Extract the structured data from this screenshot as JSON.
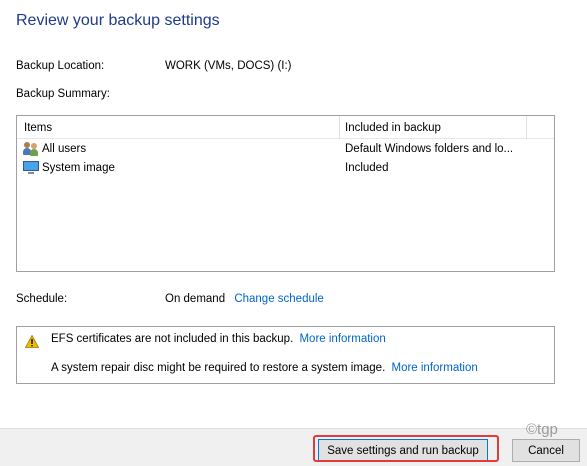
{
  "title": "Review your backup settings",
  "backup_location": {
    "label": "Backup Location:",
    "value": "WORK (VMs, DOCS) (I:)"
  },
  "backup_summary": {
    "label": "Backup Summary:"
  },
  "table": {
    "columns": [
      "Items",
      "Included in backup"
    ],
    "rows": [
      {
        "icon": "users-icon",
        "name": "All users",
        "included": "Default Windows folders and lo..."
      },
      {
        "icon": "monitor-icon",
        "name": "System image",
        "included": "Included"
      }
    ]
  },
  "schedule": {
    "label": "Schedule:",
    "value": "On demand",
    "link": "Change schedule"
  },
  "notices": [
    {
      "text": "EFS certificates are not included in this backup.",
      "link": "More information"
    },
    {
      "text": "A system repair disc might be required to restore a system image.",
      "link": "More information"
    }
  ],
  "buttons": {
    "primary": "Save settings and run backup",
    "cancel": "Cancel"
  },
  "watermark": "©tgp",
  "colors": {
    "title": "#1e3a8a",
    "link": "#0066cc",
    "highlight": "#e23b3b",
    "warning": "#f0c000"
  }
}
